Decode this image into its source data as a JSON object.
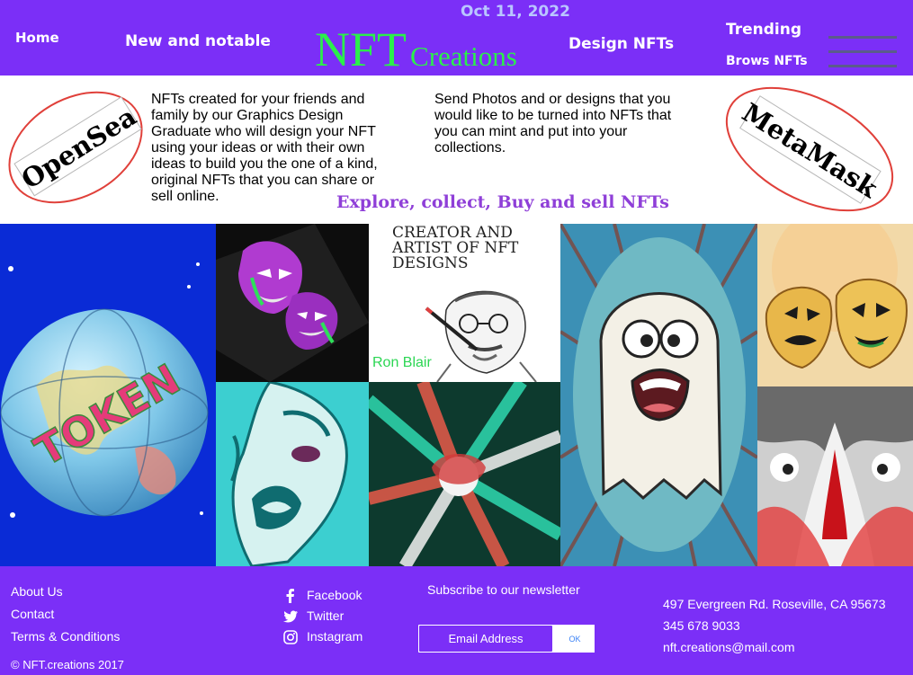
{
  "header": {
    "date": "Oct 11, 2022",
    "logo_big": "NFT",
    "logo_small": "Creations",
    "nav": {
      "home": "Home",
      "new_and_notable": "New and notable",
      "design_nfts": "Design NFTs",
      "trending": "Trending",
      "brows_nfts": "Brows NFTs"
    },
    "menu_icon": "hamburger-menu-icon"
  },
  "intro": {
    "badge_left": "OpenSea",
    "badge_right": "MetaMask",
    "paragraph_left": "NFTs created for your friends and family by our Graphics Design Graduate who will design your NFT using your ideas or with their own ideas to build you the one of a kind, original NFTs that you can share or sell online.",
    "paragraph_right": "Send Photos and or designs that you would like to be turned into NFTs that you can mint and put into your collections.",
    "tagline": "Explore, collect, Buy and sell NFTs"
  },
  "gallery": {
    "token_text": "TOKEN",
    "creator_title_line1": "CREATOR AND",
    "creator_title_line2": "ARTIST OF NFT",
    "creator_title_line3": "DESIGNS",
    "creator_name": "Ron Blair"
  },
  "footer": {
    "links": {
      "about": "About Us",
      "contact": "Contact",
      "terms": "Terms & Conditions"
    },
    "copyright": "© NFT.creations 2017",
    "social": {
      "facebook": "Facebook",
      "twitter": "Twitter",
      "instagram": "Instagram"
    },
    "newsletter": {
      "label": "Subscribe to our newsletter",
      "placeholder": "Email Address",
      "button": "OK"
    },
    "contact": {
      "address": "497 Evergreen Rd. Roseville, CA 95673",
      "phone": "345 678 9033",
      "email": "nft.creations@mail.com"
    }
  },
  "colors": {
    "brand_purple": "#7b2ff7",
    "logo_green": "#2bef4b",
    "tagline_purple": "#8f3fd8",
    "date_blue": "#b9c6ff"
  }
}
